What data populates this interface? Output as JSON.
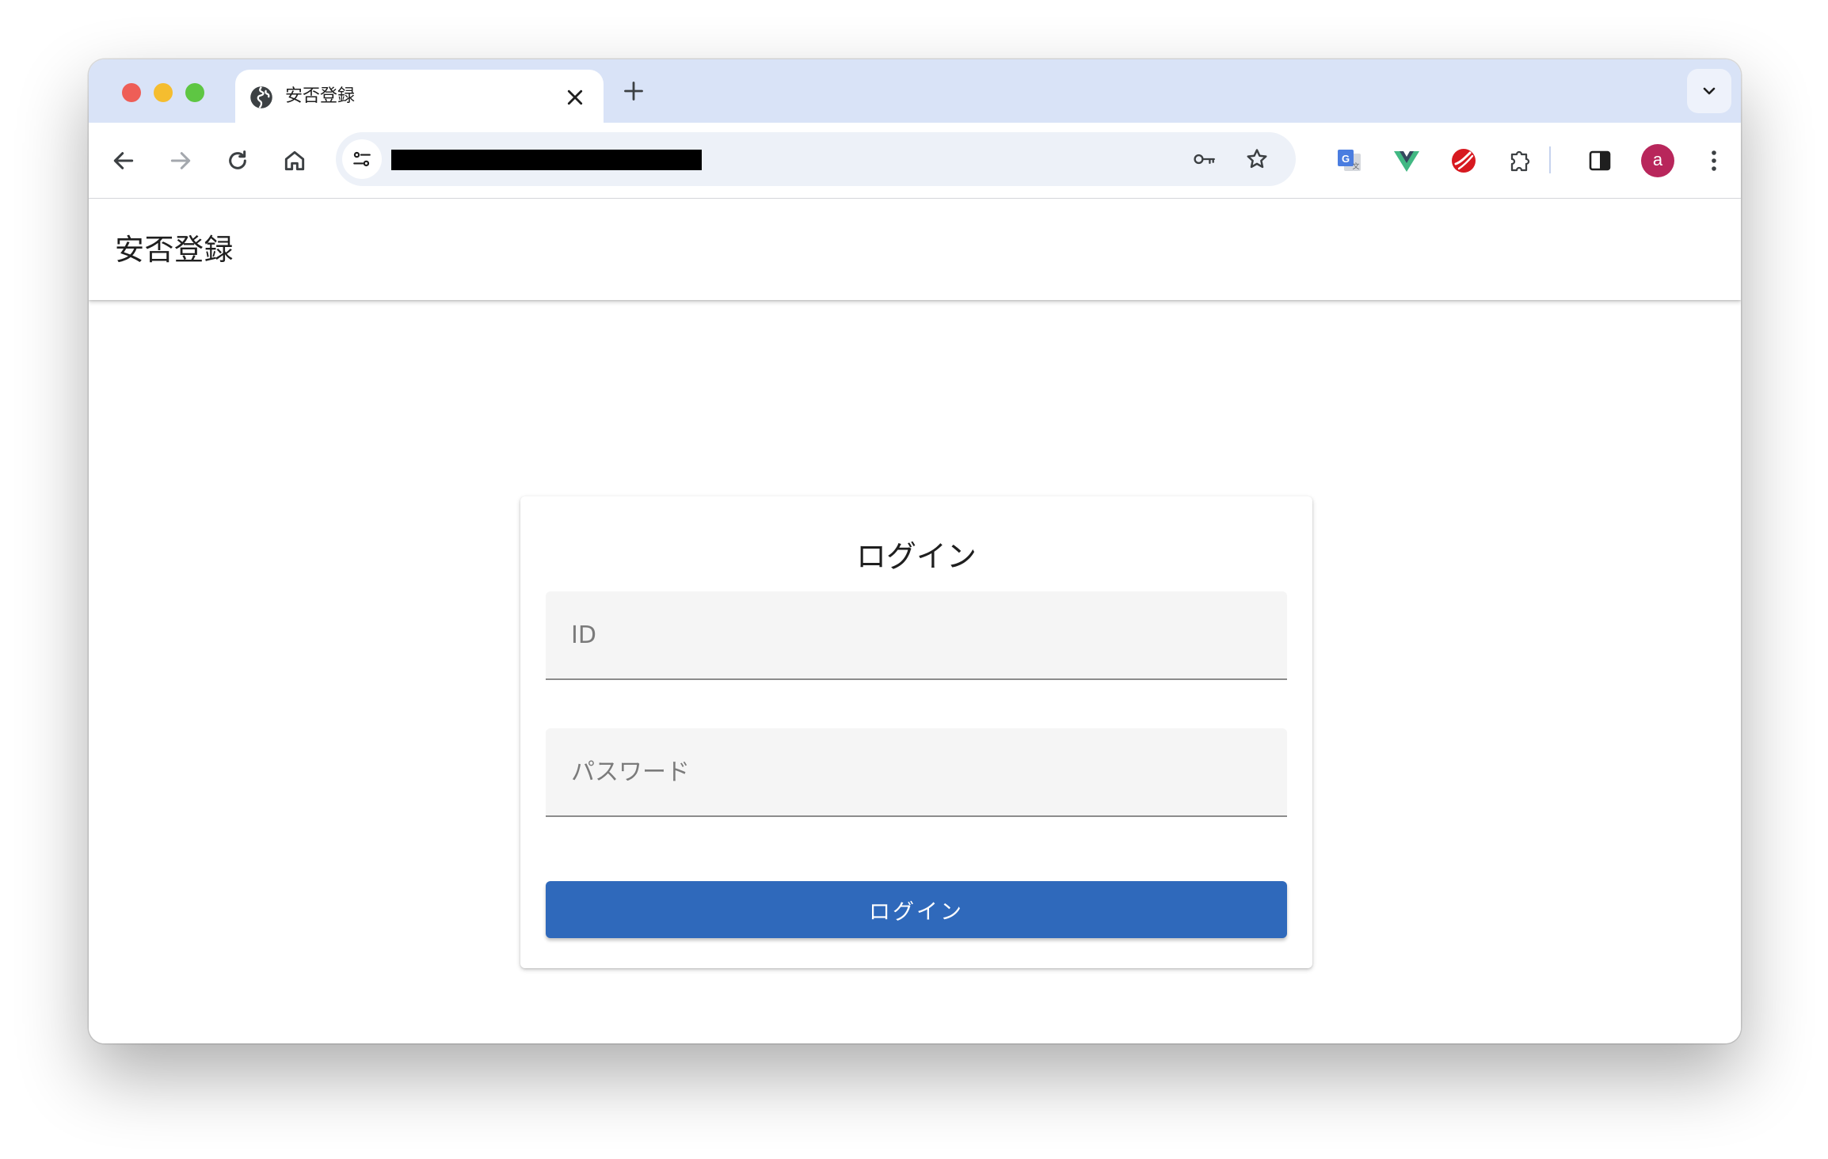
{
  "browser": {
    "tab": {
      "title": "安否登録"
    },
    "address_bar": {
      "url_text": ""
    },
    "profile": {
      "initial": "a",
      "color": "#b8265b"
    },
    "colors": {
      "tabstrip": "#d9e3f7",
      "omnibox": "#edf1f8"
    },
    "extensions": [
      "google-translate-icon",
      "vue-devtools-icon",
      "trend-micro-icon",
      "puzzle-extensions-icon"
    ]
  },
  "app": {
    "title": "安否登録"
  },
  "login": {
    "heading": "ログイン",
    "id_placeholder": "ID",
    "password_placeholder": "パスワード",
    "button_label": "ログイン",
    "button_color": "#2f69bb"
  }
}
